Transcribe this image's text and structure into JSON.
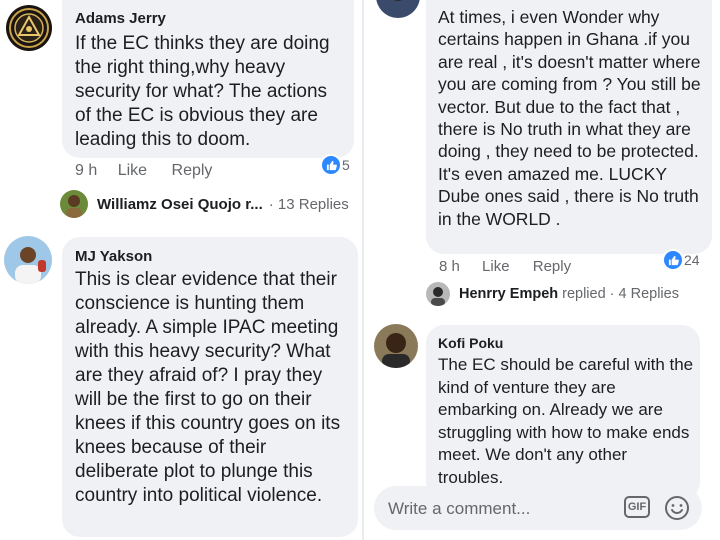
{
  "left_panel": {
    "comment1": {
      "author": "Adams Jerry",
      "text": "If the EC thinks they are doing the right thing,why heavy security for what? The actions of the EC is obvious they are leading this to doom.",
      "time": "9 h",
      "like_label": "Like",
      "reply_label": "Reply",
      "reaction_count": "5",
      "reply_preview_name": "Williamz Osei Quojo r...",
      "reply_preview_count": "· 13 Replies"
    },
    "comment2": {
      "author": "MJ Yakson",
      "text": "This is clear evidence that their conscience is hunting them already. A simple IPAC meeting with this heavy security? What are they afraid of? I pray they will be the first to go on their knees if this country goes on its knees because of their deliberate plot to plunge this country into political violence."
    }
  },
  "right_panel": {
    "comment1": {
      "text": "At times, i  even Wonder why certains happen in Ghana .if you are real , it's doesn't matter where you are coming from  ? You still be  vector. But due to the fact that , there is No truth in what they are doing , they need to be protected. It's even amazed me. LUCKY Dube  ones said , there is No truth in the WORLD .",
      "time": "8 h",
      "like_label": "Like",
      "reply_label": "Reply",
      "reaction_count": "24",
      "reply_preview_name": "Henrry Empeh",
      "reply_preview_verb": "replied",
      "reply_preview_count": "· 4 Replies"
    },
    "comment2": {
      "author": "Kofi Poku",
      "text": "The EC should be careful with the kind of venture they are embarking on. Already we are struggling with how to make ends meet. We don't any other troubles."
    },
    "composer": {
      "placeholder": "Write a comment...",
      "gif_label": "GIF"
    }
  },
  "icons": {
    "like": "thumbs-up-icon",
    "emoji": "smiley-icon",
    "gif": "gif-icon"
  },
  "colors": {
    "bubble": "#eff1f4",
    "like_blue": "#2d88ff",
    "muted_text": "#65676b"
  }
}
